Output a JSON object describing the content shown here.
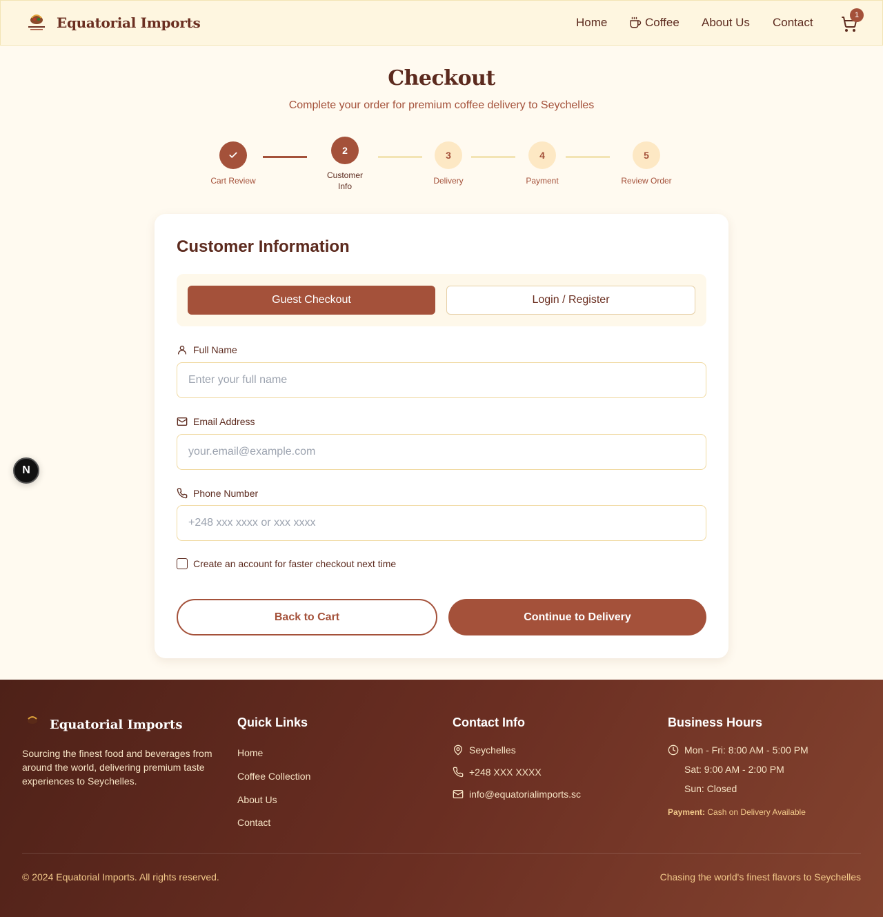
{
  "header": {
    "brand": "Equatorial Imports",
    "nav": {
      "home": "Home",
      "coffee": "Coffee",
      "about": "About Us",
      "contact": "Contact"
    },
    "cart_count": "1"
  },
  "page": {
    "title": "Checkout",
    "subtitle": "Complete your order for premium coffee delivery to Seychelles"
  },
  "steps": [
    {
      "number": "",
      "label": "Cart Review",
      "state": "done"
    },
    {
      "number": "2",
      "label": "Customer Info",
      "state": "active"
    },
    {
      "number": "3",
      "label": "Delivery",
      "state": "todo"
    },
    {
      "number": "4",
      "label": "Payment",
      "state": "todo"
    },
    {
      "number": "5",
      "label": "Review Order",
      "state": "todo"
    }
  ],
  "form": {
    "title": "Customer Information",
    "tabs": {
      "guest": "Guest Checkout",
      "login": "Login / Register"
    },
    "full_name": {
      "label": "Full Name",
      "placeholder": "Enter your full name",
      "value": ""
    },
    "email": {
      "label": "Email Address",
      "placeholder": "your.email@example.com",
      "value": ""
    },
    "phone": {
      "label": "Phone Number",
      "placeholder": "+248 xxx xxxx or xxx xxxx",
      "value": ""
    },
    "create_account": "Create an account for faster checkout next time",
    "back_button": "Back to Cart",
    "continue_button": "Continue to Delivery"
  },
  "floating_badge": "N",
  "footer": {
    "brand": "Equatorial Imports",
    "description": "Sourcing the finest food and beverages from around the world, delivering premium taste experiences to Seychelles.",
    "quick_links_title": "Quick Links",
    "quick_links": [
      "Home",
      "Coffee Collection",
      "About Us",
      "Contact"
    ],
    "contact_title": "Contact Info",
    "contact": {
      "location": "Seychelles",
      "phone": "+248 XXX XXXX",
      "email": "info@equatorialimports.sc"
    },
    "hours_title": "Business Hours",
    "hours": [
      "Mon - Fri: 8:00 AM - 5:00 PM",
      "Sat: 9:00 AM - 2:00 PM",
      "Sun: Closed"
    ],
    "payment_label": "Payment:",
    "payment_text": "Cash on Delivery Available",
    "copyright": "© 2024 Equatorial Imports. All rights reserved.",
    "tagline": "Chasing the world's finest flavors to Seychelles"
  },
  "colors": {
    "accent": "#a4513a",
    "cream": "#fffaf0",
    "brown": "#5c2a1e"
  }
}
